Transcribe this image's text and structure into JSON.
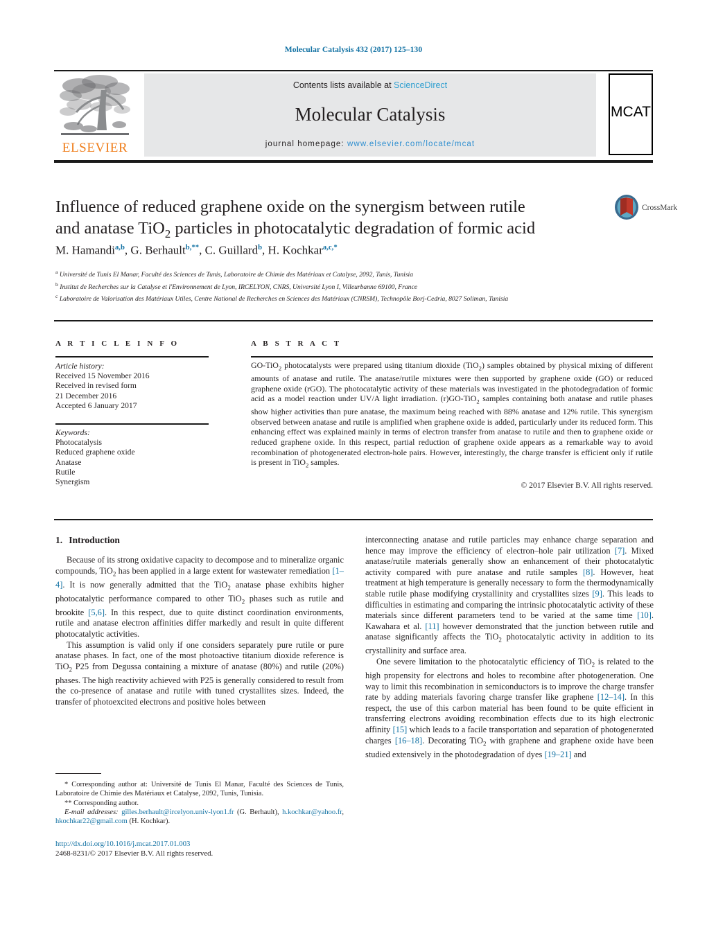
{
  "running_head": "Molecular Catalysis 432 (2017) 125–130",
  "masthead": {
    "publisher_logo_label": "ELSEVIER",
    "contents_prefix": "Contents lists available at ",
    "contents_link": "ScienceDirect",
    "journal_name": "Molecular Catalysis",
    "homepage_prefix": "journal homepage: ",
    "homepage_url": "www.elsevier.com/locate/mcat",
    "journal_badge": "MCAT"
  },
  "article": {
    "title_line1": "Influence of reduced graphene oxide on the synergism between rutile",
    "title_line2_a": "and anatase TiO",
    "title_line2_sub": "2",
    "title_line2_b": " particles in photocatalytic degradation of formic acid",
    "crossmark_label": "CrossMark",
    "authors": [
      {
        "name": "M. Hamandi",
        "sup": "a,b"
      },
      {
        "name": "G. Berhault",
        "sup": "b,**"
      },
      {
        "name": "C. Guillard",
        "sup": "b"
      },
      {
        "name": "H. Kochkar",
        "sup": "a,c,*"
      }
    ],
    "affiliations": [
      {
        "mark": "a",
        "text": "Université de Tunis El Manar, Faculté des Sciences de Tunis, Laboratoire de Chimie des Matériaux et Catalyse, 2092, Tunis, Tunisia"
      },
      {
        "mark": "b",
        "text": "Institut de Recherches sur la Catalyse et l'Environnement de Lyon, IRCELYON, CNRS, Université Lyon I, Villeurbanne 69100, France"
      },
      {
        "mark": "c",
        "text": "Laboratoire de Valorisation des Matériaux Utiles, Centre National de Recherches en Sciences des Matériaux (CNRSM), Technopôle Borj-Cedria, 8027 Soliman, Tunisia"
      }
    ]
  },
  "article_info": {
    "heading": "A R T I C L E   I N F O",
    "history_label": "Article history:",
    "history": [
      "Received 15 November 2016",
      "Received in revised form",
      "21 December 2016",
      "Accepted 6 January 2017"
    ],
    "keywords_label": "Keywords:",
    "keywords": [
      "Photocatalysis",
      "Reduced graphene oxide",
      "Anatase",
      "Rutile",
      "Synergism"
    ]
  },
  "abstract": {
    "heading": "A B S T R A C T",
    "part1": "GO-TiO",
    "part2": " photocatalysts were prepared using titanium dioxide (TiO",
    "part3": ") samples obtained by physical mixing of different amounts of anatase and rutile. The anatase/rutile mixtures were then supported by graphene oxide (GO) or reduced graphene oxide (rGO). The photocatalytic activity of these materials was investigated in the photodegradation of formic acid as a model reaction under UV/A light irradiation. (r)GO-TiO",
    "part4": " samples containing both anatase and rutile phases show higher activities than pure anatase, the maximum being reached with 88% anatase and 12% rutile. This synergism observed between anatase and rutile is amplified when graphene oxide is added, particularly under its reduced form. This enhancing effect was explained mainly in terms of electron transfer from anatase to rutile and then to graphene oxide or reduced graphene oxide. In this respect, partial reduction of graphene oxide appears as a remarkable way to avoid recombination of photogenerated electron-hole pairs. However, interestingly, the charge transfer is efficient only if rutile is present in TiO",
    "part5": " samples.",
    "copyright": "© 2017 Elsevier B.V. All rights reserved."
  },
  "introduction": {
    "number": "1.",
    "heading": "Introduction",
    "left_paragraphs": [
      {
        "segments": [
          {
            "t": "Because of its strong oxidative capacity to decompose and to mineralize organic compounds, TiO",
            "k": "text"
          },
          {
            "t": "2",
            "k": "sub"
          },
          {
            "t": " has been applied in a large extent for wastewater remediation ",
            "k": "text"
          },
          {
            "t": "[1–4]",
            "k": "ref"
          },
          {
            "t": ". It is now generally admitted that the TiO",
            "k": "text"
          },
          {
            "t": "2",
            "k": "sub"
          },
          {
            "t": " anatase phase exhibits higher photocatalytic performance compared to other TiO",
            "k": "text"
          },
          {
            "t": "2",
            "k": "sub"
          },
          {
            "t": " phases such as rutile and brookite ",
            "k": "text"
          },
          {
            "t": "[5,6]",
            "k": "ref"
          },
          {
            "t": ". In this respect, due to quite distinct coordination environments, rutile and anatase electron affinities differ markedly and result in quite different photocatalytic activities.",
            "k": "text"
          }
        ]
      },
      {
        "segments": [
          {
            "t": "This assumption is valid only if one considers separately pure rutile or pure anatase phases. In fact, one of the most photoactive titanium dioxide reference is TiO",
            "k": "text"
          },
          {
            "t": "2",
            "k": "sub"
          },
          {
            "t": " P25 from Degussa containing a mixture of anatase (80%) and rutile (20%) phases. The high reactivity achieved with P25 is generally considered to result from the co-presence of anatase and rutile with tuned crystallites sizes. Indeed, the transfer of photoexcited electrons and positive holes between",
            "k": "text"
          }
        ]
      }
    ],
    "right_paragraphs": [
      {
        "continuation": true,
        "segments": [
          {
            "t": "interconnecting anatase and rutile particles may enhance charge separation and hence may improve the efficiency of electron–hole pair utilization ",
            "k": "text"
          },
          {
            "t": "[7]",
            "k": "ref"
          },
          {
            "t": ". Mixed anatase/rutile materials generally show an enhancement of their photocatalytic activity compared with pure anatase and rutile samples ",
            "k": "text"
          },
          {
            "t": "[8]",
            "k": "ref"
          },
          {
            "t": ". However, heat treatment at high temperature is generally necessary to form the thermodynamically stable rutile phase modifying crystallinity and crystallites sizes ",
            "k": "text"
          },
          {
            "t": "[9]",
            "k": "ref"
          },
          {
            "t": ". This leads to difficulties in estimating and comparing the intrinsic photocatalytic activity of these materials since different parameters tend to be varied at the same time ",
            "k": "text"
          },
          {
            "t": "[10]",
            "k": "ref"
          },
          {
            "t": ". Kawahara et al. ",
            "k": "text"
          },
          {
            "t": "[11]",
            "k": "ref"
          },
          {
            "t": " however demonstrated that the junction between rutile and anatase significantly affects the TiO",
            "k": "text"
          },
          {
            "t": "2",
            "k": "sub"
          },
          {
            "t": " photocatalytic activity in addition to its crystallinity and surface area.",
            "k": "text"
          }
        ]
      },
      {
        "segments": [
          {
            "t": "One severe limitation to the photocatalytic efficiency of TiO",
            "k": "text"
          },
          {
            "t": "2",
            "k": "sub"
          },
          {
            "t": " is related to the high propensity for electrons and holes to recombine after photogeneration. One way to limit this recombination in semiconductors is to improve the charge transfer rate by adding materials favoring charge transfer like graphene ",
            "k": "text"
          },
          {
            "t": "[12–14]",
            "k": "ref"
          },
          {
            "t": ". In this respect, the use of this carbon material has been found to be quite efficient in transferring electrons avoiding recombination effects due to its high electronic affinity ",
            "k": "text"
          },
          {
            "t": "[15]",
            "k": "ref"
          },
          {
            "t": " which leads to a facile transportation and separation of photogenerated charges ",
            "k": "text"
          },
          {
            "t": "[16–18]",
            "k": "ref"
          },
          {
            "t": ". Decorating TiO",
            "k": "text"
          },
          {
            "t": "2",
            "k": "sub"
          },
          {
            "t": " with graphene and graphene oxide have been studied extensively in the photodegradation of dyes ",
            "k": "text"
          },
          {
            "t": "[19–21]",
            "k": "ref"
          },
          {
            "t": " and",
            "k": "text"
          }
        ]
      }
    ]
  },
  "footnotes": {
    "line1": "* Corresponding author at: Université de Tunis El Manar, Faculté des Sciences de Tunis, Laboratoire de Chimie des Matériaux et Catalyse, 2092, Tunis, Tunisia.",
    "line2": "** Corresponding author.",
    "email_label": "E-mail addresses:",
    "email1": "gilles.berhault@ircelyon.univ-lyon1.fr",
    "email1_owner": " (G. Berhault),",
    "email2": "h.kochkar@yahoo.fr",
    "email3": "hkochkar22@gmail.com",
    "email_owner2": " (H. Kochkar)."
  },
  "doi_block": {
    "doi_url": "http://dx.doi.org/10.1016/j.mcat.2017.01.003",
    "issn_line": "2468-8231/© 2017 Elsevier B.V. All rights reserved."
  },
  "colors": {
    "link_blue": "#1171a3",
    "sciencedirect_blue": "#2f9fd0",
    "elsevier_orange": "#ef7d1a",
    "band_gray": "#e6e7e8",
    "text_black": "#231f20"
  }
}
